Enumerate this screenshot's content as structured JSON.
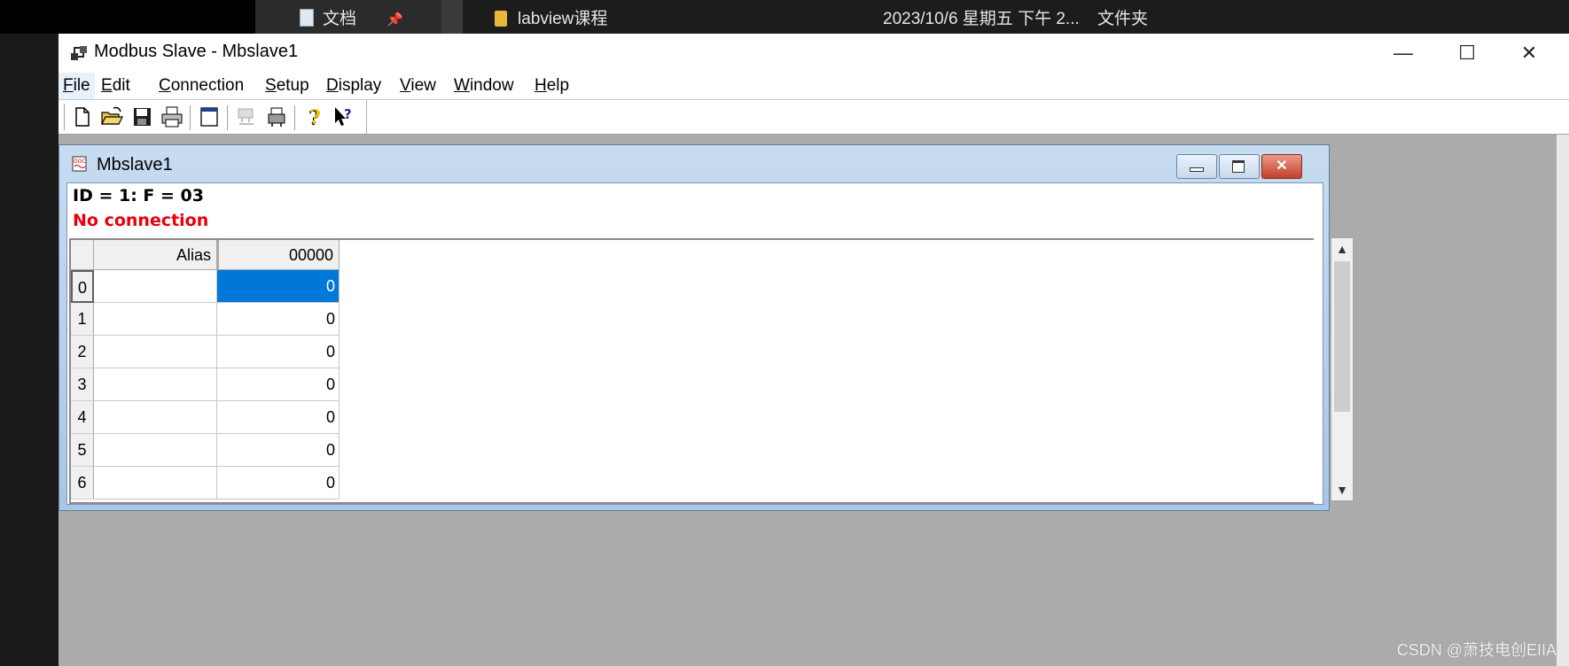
{
  "background": {
    "doc_label": "文档",
    "folder_label": "labview课程",
    "date": "2023/10/6 星期五 下午 2...",
    "type": "文件夹"
  },
  "window": {
    "title": "Modbus Slave - Mbslave1",
    "minimize": "—",
    "maximize": "☐",
    "close": "✕"
  },
  "menu": {
    "items": [
      {
        "u": "F",
        "rest": "ile"
      },
      {
        "u": "E",
        "rest": "dit"
      },
      {
        "u": "C",
        "rest": "onnection"
      },
      {
        "u": "S",
        "rest": "etup"
      },
      {
        "u": "D",
        "rest": "isplay"
      },
      {
        "u": "V",
        "rest": "iew"
      },
      {
        "u": "W",
        "rest": "indow"
      },
      {
        "u": "H",
        "rest": "elp"
      }
    ]
  },
  "toolbar": {
    "buttons": [
      "new-document-icon",
      "open-folder-icon",
      "save-icon",
      "print-icon",
      "window-icon",
      "disconnect-icon",
      "device-icon",
      "help-icon",
      "context-help-icon"
    ]
  },
  "child": {
    "title": "Mbslave1",
    "id_line": "ID = 1: F = 03",
    "status": "No connection",
    "grid": {
      "col_alias": "Alias",
      "col_address": "00000",
      "rows": [
        {
          "index": "0",
          "alias": "",
          "value": "0"
        },
        {
          "index": "1",
          "alias": "",
          "value": "0"
        },
        {
          "index": "2",
          "alias": "",
          "value": "0"
        },
        {
          "index": "3",
          "alias": "",
          "value": "0"
        },
        {
          "index": "4",
          "alias": "",
          "value": "0"
        },
        {
          "index": "5",
          "alias": "",
          "value": "0"
        },
        {
          "index": "6",
          "alias": "",
          "value": "0"
        }
      ]
    }
  },
  "watermark": "CSDN @萧技电创EIIA",
  "colors": {
    "status_error": "#e8000b",
    "selection": "#0078d7",
    "workspace": "#ababab"
  }
}
